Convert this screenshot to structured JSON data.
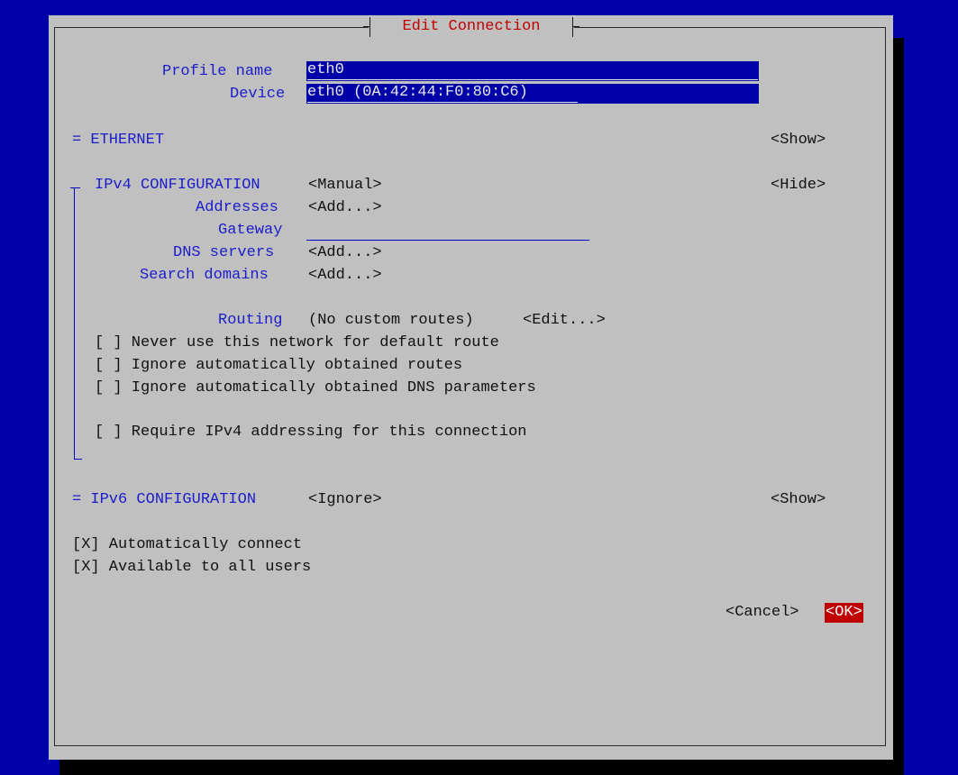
{
  "dialog": {
    "title": "Edit Connection"
  },
  "profile": {
    "label": "Profile name",
    "value": "eth0"
  },
  "device": {
    "label": "Device",
    "value": "eth0 (0A:42:44:F0:80:C6)"
  },
  "ethernet": {
    "header": "= ETHERNET",
    "toggle": "<Show>"
  },
  "ipv4": {
    "header": "IPv4 CONFIGURATION",
    "mode": "<Manual>",
    "toggle": "<Hide>",
    "addresses": {
      "label": "Addresses",
      "button": "<Add...>"
    },
    "gateway": {
      "label": "Gateway",
      "value": ""
    },
    "dns": {
      "label": "DNS servers",
      "button": "<Add...>"
    },
    "search": {
      "label": "Search domains",
      "button": "<Add...>"
    },
    "routing": {
      "label": "Routing",
      "value": "(No custom routes)",
      "button": "<Edit...>"
    },
    "never_default": "[ ] Never use this network for default route",
    "ignore_routes": "[ ] Ignore automatically obtained routes",
    "ignore_dns": "[ ] Ignore automatically obtained DNS parameters",
    "require_ipv4": "[ ] Require IPv4 addressing for this connection"
  },
  "ipv6": {
    "header": "= IPv6 CONFIGURATION",
    "mode": "<Ignore>",
    "toggle": "<Show>"
  },
  "auto_connect": "[X] Automatically connect",
  "all_users": "[X] Available to all users",
  "buttons": {
    "cancel": "<Cancel>",
    "ok": "<OK>"
  },
  "colors": {
    "background": "#0000a8",
    "dialog": "#c0c0c0",
    "label": "#1c1ccc",
    "accent": "#c00000"
  }
}
